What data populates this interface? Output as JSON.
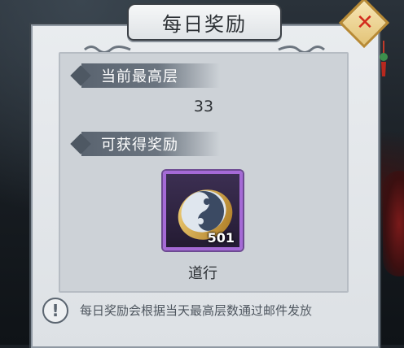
{
  "dialog": {
    "title": "每日奖励",
    "close_icon": "close-x-icon"
  },
  "current_floor": {
    "label": "当前最高层",
    "value": "33"
  },
  "rewards": {
    "label": "可获得奖励",
    "items": [
      {
        "name": "道行",
        "count": "501",
        "icon": "taiji-jade-icon"
      }
    ]
  },
  "tip": {
    "icon": "exclamation-icon",
    "text": "每日奖励会根据当天最高层数通过邮件发放"
  },
  "colors": {
    "title_text": "#2b2f33",
    "banner": "#5a6470",
    "item_frame": "#a56ad6",
    "close_red": "#d22a1c",
    "close_gold": "#e3c478"
  }
}
